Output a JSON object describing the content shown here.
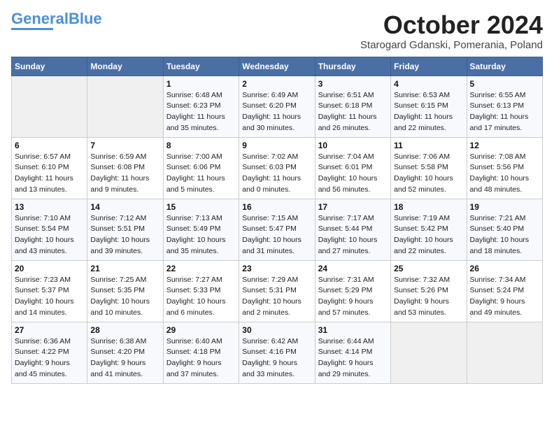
{
  "logo": {
    "line1": "General",
    "line2": "Blue"
  },
  "title": "October 2024",
  "location": "Starogard Gdanski, Pomerania, Poland",
  "weekdays": [
    "Sunday",
    "Monday",
    "Tuesday",
    "Wednesday",
    "Thursday",
    "Friday",
    "Saturday"
  ],
  "weeks": [
    [
      {
        "day": "",
        "info": ""
      },
      {
        "day": "",
        "info": ""
      },
      {
        "day": "1",
        "info": "Sunrise: 6:48 AM\nSunset: 6:23 PM\nDaylight: 11 hours\nand 35 minutes."
      },
      {
        "day": "2",
        "info": "Sunrise: 6:49 AM\nSunset: 6:20 PM\nDaylight: 11 hours\nand 30 minutes."
      },
      {
        "day": "3",
        "info": "Sunrise: 6:51 AM\nSunset: 6:18 PM\nDaylight: 11 hours\nand 26 minutes."
      },
      {
        "day": "4",
        "info": "Sunrise: 6:53 AM\nSunset: 6:15 PM\nDaylight: 11 hours\nand 22 minutes."
      },
      {
        "day": "5",
        "info": "Sunrise: 6:55 AM\nSunset: 6:13 PM\nDaylight: 11 hours\nand 17 minutes."
      }
    ],
    [
      {
        "day": "6",
        "info": "Sunrise: 6:57 AM\nSunset: 6:10 PM\nDaylight: 11 hours\nand 13 minutes."
      },
      {
        "day": "7",
        "info": "Sunrise: 6:59 AM\nSunset: 6:08 PM\nDaylight: 11 hours\nand 9 minutes."
      },
      {
        "day": "8",
        "info": "Sunrise: 7:00 AM\nSunset: 6:06 PM\nDaylight: 11 hours\nand 5 minutes."
      },
      {
        "day": "9",
        "info": "Sunrise: 7:02 AM\nSunset: 6:03 PM\nDaylight: 11 hours\nand 0 minutes."
      },
      {
        "day": "10",
        "info": "Sunrise: 7:04 AM\nSunset: 6:01 PM\nDaylight: 10 hours\nand 56 minutes."
      },
      {
        "day": "11",
        "info": "Sunrise: 7:06 AM\nSunset: 5:58 PM\nDaylight: 10 hours\nand 52 minutes."
      },
      {
        "day": "12",
        "info": "Sunrise: 7:08 AM\nSunset: 5:56 PM\nDaylight: 10 hours\nand 48 minutes."
      }
    ],
    [
      {
        "day": "13",
        "info": "Sunrise: 7:10 AM\nSunset: 5:54 PM\nDaylight: 10 hours\nand 43 minutes."
      },
      {
        "day": "14",
        "info": "Sunrise: 7:12 AM\nSunset: 5:51 PM\nDaylight: 10 hours\nand 39 minutes."
      },
      {
        "day": "15",
        "info": "Sunrise: 7:13 AM\nSunset: 5:49 PM\nDaylight: 10 hours\nand 35 minutes."
      },
      {
        "day": "16",
        "info": "Sunrise: 7:15 AM\nSunset: 5:47 PM\nDaylight: 10 hours\nand 31 minutes."
      },
      {
        "day": "17",
        "info": "Sunrise: 7:17 AM\nSunset: 5:44 PM\nDaylight: 10 hours\nand 27 minutes."
      },
      {
        "day": "18",
        "info": "Sunrise: 7:19 AM\nSunset: 5:42 PM\nDaylight: 10 hours\nand 22 minutes."
      },
      {
        "day": "19",
        "info": "Sunrise: 7:21 AM\nSunset: 5:40 PM\nDaylight: 10 hours\nand 18 minutes."
      }
    ],
    [
      {
        "day": "20",
        "info": "Sunrise: 7:23 AM\nSunset: 5:37 PM\nDaylight: 10 hours\nand 14 minutes."
      },
      {
        "day": "21",
        "info": "Sunrise: 7:25 AM\nSunset: 5:35 PM\nDaylight: 10 hours\nand 10 minutes."
      },
      {
        "day": "22",
        "info": "Sunrise: 7:27 AM\nSunset: 5:33 PM\nDaylight: 10 hours\nand 6 minutes."
      },
      {
        "day": "23",
        "info": "Sunrise: 7:29 AM\nSunset: 5:31 PM\nDaylight: 10 hours\nand 2 minutes."
      },
      {
        "day": "24",
        "info": "Sunrise: 7:31 AM\nSunset: 5:29 PM\nDaylight: 9 hours\nand 57 minutes."
      },
      {
        "day": "25",
        "info": "Sunrise: 7:32 AM\nSunset: 5:26 PM\nDaylight: 9 hours\nand 53 minutes."
      },
      {
        "day": "26",
        "info": "Sunrise: 7:34 AM\nSunset: 5:24 PM\nDaylight: 9 hours\nand 49 minutes."
      }
    ],
    [
      {
        "day": "27",
        "info": "Sunrise: 6:36 AM\nSunset: 4:22 PM\nDaylight: 9 hours\nand 45 minutes."
      },
      {
        "day": "28",
        "info": "Sunrise: 6:38 AM\nSunset: 4:20 PM\nDaylight: 9 hours\nand 41 minutes."
      },
      {
        "day": "29",
        "info": "Sunrise: 6:40 AM\nSunset: 4:18 PM\nDaylight: 9 hours\nand 37 minutes."
      },
      {
        "day": "30",
        "info": "Sunrise: 6:42 AM\nSunset: 4:16 PM\nDaylight: 9 hours\nand 33 minutes."
      },
      {
        "day": "31",
        "info": "Sunrise: 6:44 AM\nSunset: 4:14 PM\nDaylight: 9 hours\nand 29 minutes."
      },
      {
        "day": "",
        "info": ""
      },
      {
        "day": "",
        "info": ""
      }
    ]
  ]
}
